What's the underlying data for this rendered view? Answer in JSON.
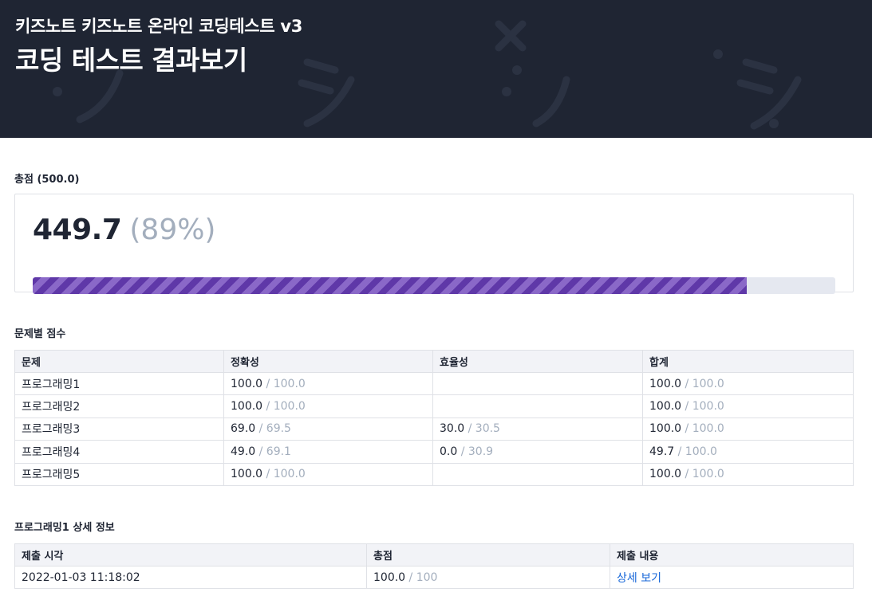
{
  "header": {
    "subtitle": "키즈노트 키즈노트 온라인 코딩테스트 v3",
    "title": "코딩 테스트 결과보기"
  },
  "total": {
    "label": "총점 (500.0)",
    "score": "449.7",
    "percent_text": "(89%)",
    "progress_fraction": 0.89
  },
  "problems": {
    "label": "문제별 점수",
    "headers": [
      "문제",
      "정확성",
      "효율성",
      "합계"
    ],
    "rows": [
      {
        "name": "프로그래밍1",
        "acc": "100.0",
        "acc_max": "100.0",
        "eff": "",
        "eff_max": "",
        "sum": "100.0",
        "sum_max": "100.0"
      },
      {
        "name": "프로그래밍2",
        "acc": "100.0",
        "acc_max": "100.0",
        "eff": "",
        "eff_max": "",
        "sum": "100.0",
        "sum_max": "100.0"
      },
      {
        "name": "프로그래밍3",
        "acc": "69.0",
        "acc_max": "69.5",
        "eff": "30.0",
        "eff_max": "30.5",
        "sum": "100.0",
        "sum_max": "100.0"
      },
      {
        "name": "프로그래밍4",
        "acc": "49.0",
        "acc_max": "69.1",
        "eff": "0.0",
        "eff_max": "30.9",
        "sum": "49.7",
        "sum_max": "100.0"
      },
      {
        "name": "프로그래밍5",
        "acc": "100.0",
        "acc_max": "100.0",
        "eff": "",
        "eff_max": "",
        "sum": "100.0",
        "sum_max": "100.0"
      }
    ]
  },
  "detail": {
    "label": "프로그래밍1 상세 정보",
    "headers": [
      "제출 시각",
      "총점",
      "제출 내용"
    ],
    "row": {
      "time": "2022-01-03 11:18:02",
      "score": "100.0",
      "score_max": "100",
      "link": "상세 보기"
    }
  },
  "separator": " / ",
  "colors": {
    "header_bg": "#1f2533",
    "progress": "#5f38a8",
    "muted": "#a3aebd",
    "link": "#1565d8"
  }
}
